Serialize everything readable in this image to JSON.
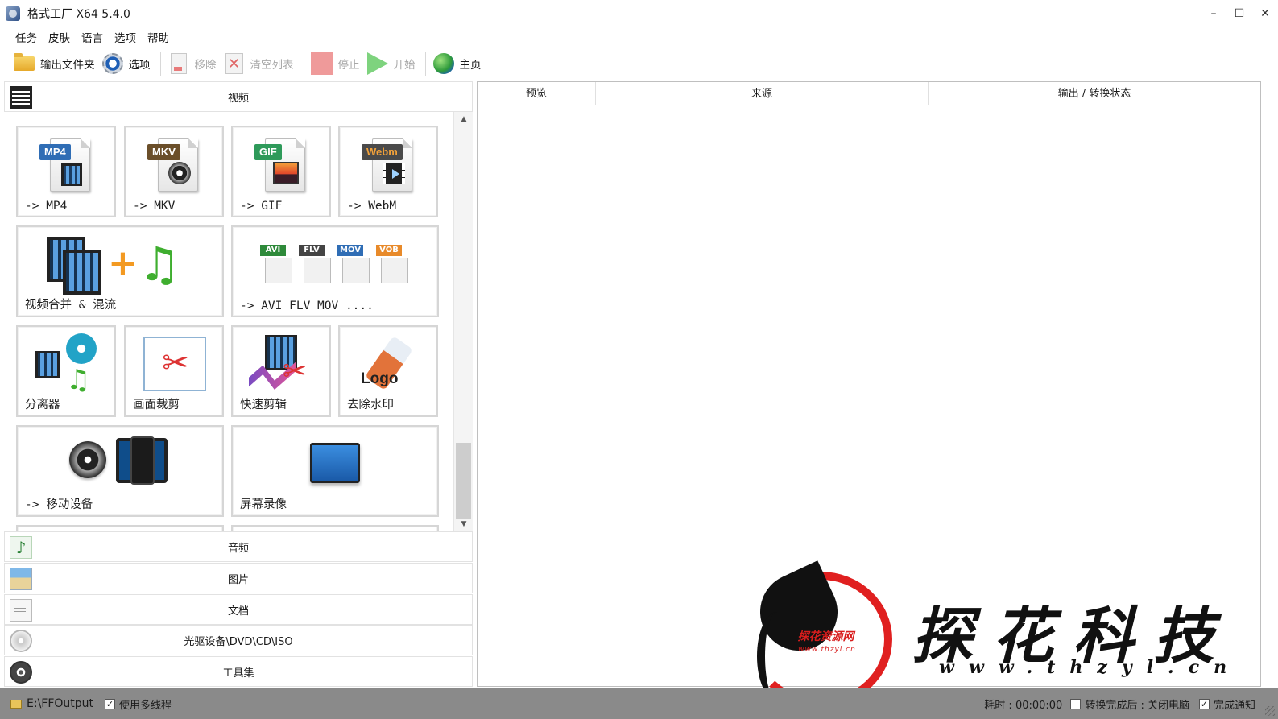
{
  "window": {
    "title": "格式工厂 X64 5.4.0",
    "minimize": "–",
    "maximize": "☐",
    "close": "✕"
  },
  "menu": [
    "任务",
    "皮肤",
    "语言",
    "选项",
    "帮助"
  ],
  "toolbar": {
    "output_folder": "输出文件夹",
    "options": "选项",
    "remove": "移除",
    "clear_list": "清空列表",
    "stop": "停止",
    "start": "开始",
    "home": "主页"
  },
  "categories": {
    "video": "视频",
    "audio": "音频",
    "picture": "图片",
    "document": "文档",
    "disc": "光驱设备\\DVD\\CD\\ISO",
    "tools": "工具集"
  },
  "video_tiles": {
    "mp4": {
      "label": "-> MP4",
      "badge": "MP4",
      "badge_color": "#2f6db5"
    },
    "mkv": {
      "label": "-> MKV",
      "badge": "MKV",
      "badge_color": "#6b4f2a"
    },
    "gif": {
      "label": "-> GIF",
      "badge": "GIF",
      "badge_color": "#2e9a5a"
    },
    "webm": {
      "label": "-> WebM",
      "badge": "Webm",
      "badge_color": "#4a4a4a"
    },
    "merge": {
      "label": "视频合并 & 混流"
    },
    "multi": {
      "label": "-> AVI FLV MOV ....",
      "badges": [
        "AVI",
        "FLV",
        "MOV",
        "VOB"
      ]
    },
    "splitter": {
      "label": "分离器"
    },
    "crop": {
      "label": "画面裁剪"
    },
    "quick_clip": {
      "label": "快速剪辑"
    },
    "remove_watermark": {
      "label": "去除水印",
      "art_text": "Logo"
    },
    "mobile": {
      "label": "-> 移动设备"
    },
    "screen_record": {
      "label": "屏幕录像"
    }
  },
  "task_table": {
    "columns": [
      "预览",
      "来源",
      "输出 / 转换状态"
    ]
  },
  "watermark": {
    "small_name": "探花资源网",
    "small_url": "www.thzyl.cn",
    "big_name": "探花科技",
    "url": "www.thzyl.cn"
  },
  "statusbar": {
    "output_path": "E:\\FFOutput",
    "multithread": "使用多线程",
    "multithread_checked": true,
    "elapsed": "耗时 : 00:00:00",
    "after_done": "转换完成后 : 关闭电脑",
    "after_done_checked": false,
    "notify": "完成通知",
    "notify_checked": true
  }
}
